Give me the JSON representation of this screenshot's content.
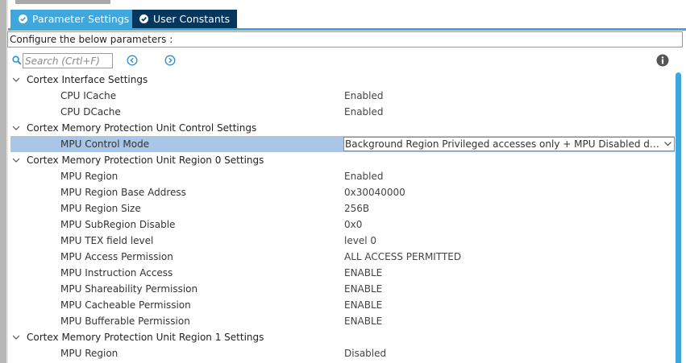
{
  "tabs": {
    "parameter_settings": "Parameter Settings",
    "user_constants": "User Constants"
  },
  "config_text": "Configure the below parameters :",
  "search": {
    "placeholder": "Search (Crtl+F)"
  },
  "icons": {
    "search": "search-icon",
    "prev": "arrow-left-circle-icon",
    "next": "arrow-right-circle-icon",
    "info": "info-icon",
    "expand": "chevron-down-icon",
    "tab_check": "check-circle-icon"
  },
  "colors": {
    "active_tab": "#3fa7dc",
    "inactive_tab": "#07365d",
    "selection": "#a9c6e8"
  },
  "tree": {
    "group_interface": "Cortex Interface Settings",
    "icache_label": "CPU ICache",
    "icache_value": "Enabled",
    "dcache_label": "CPU DCache",
    "dcache_value": "Enabled",
    "group_mpu_control": "Cortex Memory Protection Unit Control Settings",
    "mpu_control_mode_label": "MPU Control Mode",
    "mpu_control_mode_value": "Background Region Privileged accesses only + MPU Disabled du...",
    "group_region0": "Cortex Memory Protection Unit Region 0 Settings",
    "r0_region_label": "MPU Region",
    "r0_region_value": "Enabled",
    "r0_base_label": "MPU Region Base Address",
    "r0_base_value": "0x30040000",
    "r0_size_label": "MPU Region Size",
    "r0_size_value": "256B",
    "r0_subregion_label": "MPU SubRegion Disable",
    "r0_subregion_value": "0x0",
    "r0_tex_label": "MPU TEX field level",
    "r0_tex_value": "level 0",
    "r0_access_label": "MPU Access Permission",
    "r0_access_value": "ALL ACCESS PERMITTED",
    "r0_instr_label": "MPU Instruction Access",
    "r0_instr_value": "ENABLE",
    "r0_share_label": "MPU Shareability Permission",
    "r0_share_value": "ENABLE",
    "r0_cache_label": "MPU Cacheable Permission",
    "r0_cache_value": "ENABLE",
    "r0_buffer_label": "MPU Bufferable  Permission",
    "r0_buffer_value": "ENABLE",
    "group_region1": "Cortex Memory Protection Unit Region 1 Settings",
    "r1_region_label": "MPU Region",
    "r1_region_value": "Disabled"
  }
}
